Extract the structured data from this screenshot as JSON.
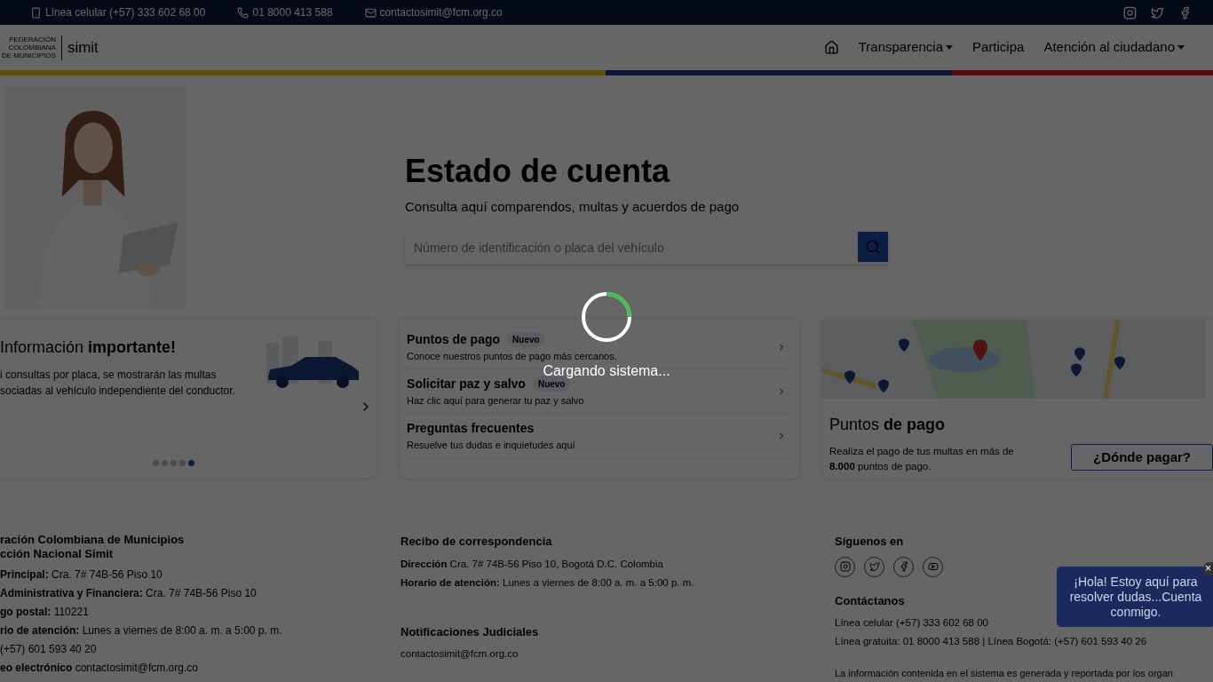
{
  "top_bar": {
    "contacts": [
      {
        "kind": "mobile",
        "text": "Línea celular (+57) 333 602 68 00"
      },
      {
        "kind": "phone",
        "text": "01 8000 413 588"
      },
      {
        "kind": "mail",
        "text": "contactosimit@fcm.org.co"
      }
    ]
  },
  "header": {
    "logo_lines": [
      "FEDERACIÓN",
      "COLOMBIANA",
      "DE MUNICIPIOS"
    ],
    "logo_word": "simit",
    "nav": [
      {
        "label": "Transparencia",
        "has_menu": true
      },
      {
        "label": "Participa",
        "has_menu": false
      },
      {
        "label": "Atención al ciudadano",
        "has_menu": true
      }
    ]
  },
  "hero": {
    "title": "Estado de cuenta",
    "subtitle": "Consulta aquí comparendos, multas y acuerdos de pago",
    "search": {
      "placeholder": "Número de identificación o placa del vehículo"
    }
  },
  "info_card": {
    "title": "Información **importante!**",
    "text": "i consultas por placa, se mostrarán las multas\nsociadas al vehículo independiente del conductor.",
    "dots": [
      {
        "selected": false
      },
      {
        "selected": false
      },
      {
        "selected": false
      },
      {
        "selected": false
      },
      {
        "selected": true
      }
    ]
  },
  "links": [
    {
      "title": "Puntos de pago",
      "badge": "Nuevo",
      "text": "Conoce nuestros puntos de pago más cercanos."
    },
    {
      "title": "Solicitar paz y salvo",
      "badge": "Nuevo",
      "text": "Haz clic aquí para generar tu paz y salvo"
    },
    {
      "title": "Preguntas frecuentes",
      "text": "Resuelve tus dudas e inquietudes aquí"
    }
  ],
  "pay_card": {
    "title": "Puntos **de pago**",
    "text": "Realiza el pago de tus multas en más de **8.000** puntos de pago.",
    "button": "¿Dónde pagar?"
  },
  "footer": {
    "col1": {
      "headings": [
        "ración Colombiana de Municipios",
        "cción Nacional Simit"
      ],
      "lines": [
        "**Principal:** Cra. 7# 74B-56 Piso 10",
        "**Administrativa y Financiera:** Cra. 7# 74B-56 Piso 10",
        "**go postal:** 110221",
        "**rio de atención:** Lunes a viernes de 8:00 a. m. a 5:00 p. m.",
        "(+57) 601 593 40 20",
        "**eo electrónico** contactosimit@fcm.org.co"
      ]
    },
    "col2": {
      "sections": [
        {
          "heading": "Recibo de correspondencia",
          "lines": [
            "**Dirección** Cra. 7# 74B-56 Piso 10, Bogotá D.C. Colombia",
            "**Horario de atención:** Lunes a viernes de 8:00 a. m. a 5:00 p. m."
          ]
        },
        {
          "heading": "Notificaciones Judiciales",
          "lines": [
            "contactosimit@fcm.org.co"
          ]
        }
      ]
    },
    "col3": {
      "follow": "Síguenos en",
      "contact_heading": "Contáctanos",
      "lines": [
        "Línea celular (+57) 333 602 68 00",
        "Línea gratuita: 01 8000 413 588 | Línea Bogotá: (+57) 601 593 40 26"
      ],
      "note": "La información contenida en el sistema es generada y reportada por los organ"
    }
  },
  "loading": {
    "text": "Cargando sistema..."
  },
  "chat": {
    "text": "¡Hola! Estoy aquí para resolver dudas...Cuenta conmigo.",
    "close": "×"
  }
}
